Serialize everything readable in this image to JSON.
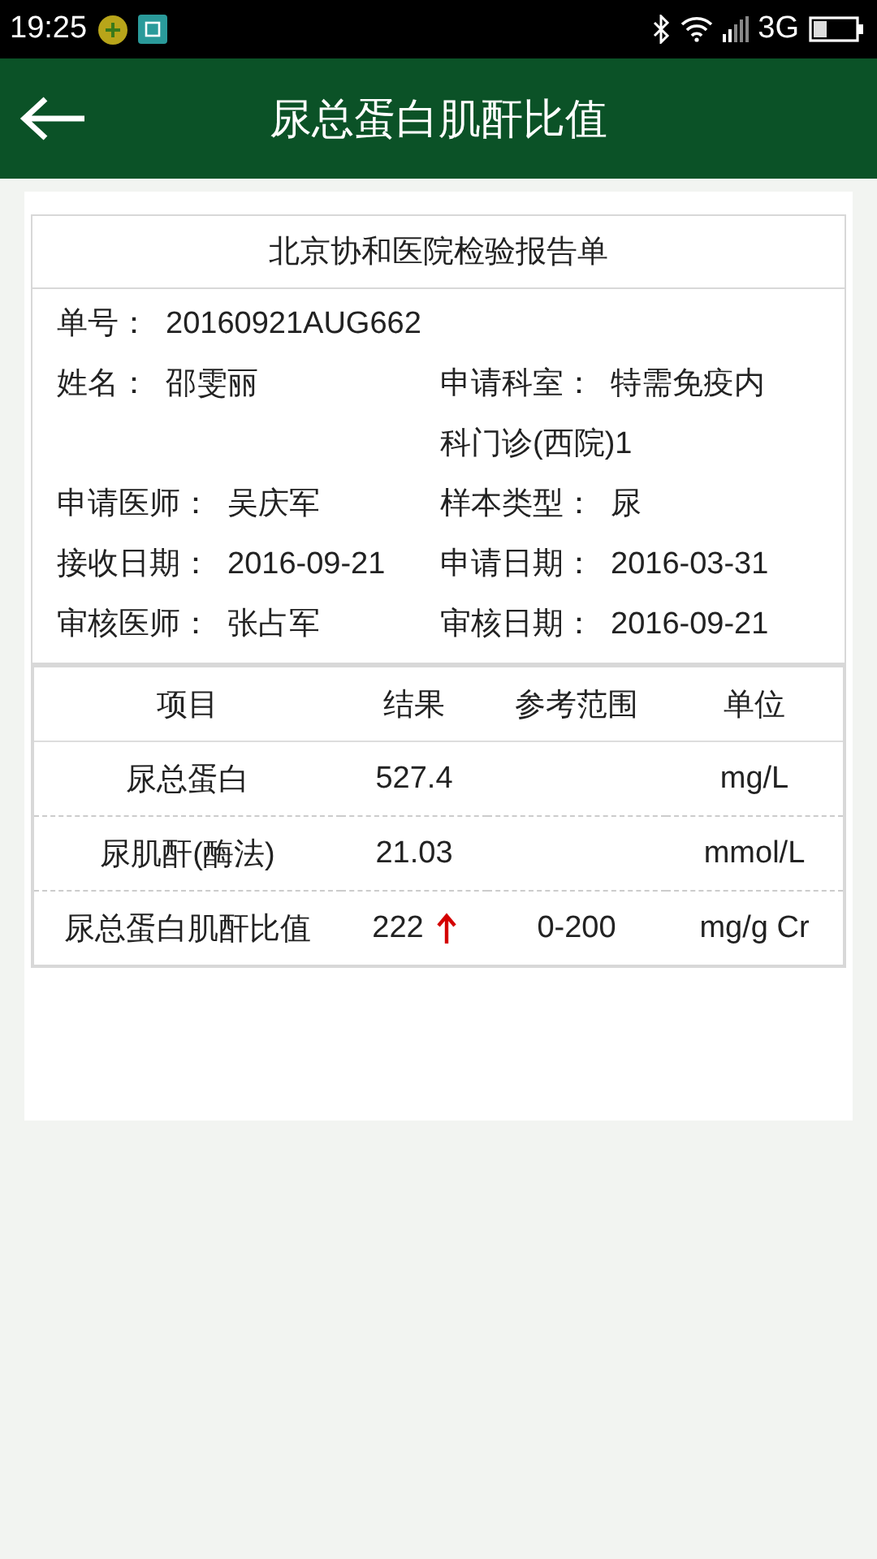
{
  "status_bar": {
    "time": "19:25",
    "network": "3G"
  },
  "header": {
    "title": "尿总蛋白肌酐比值"
  },
  "report": {
    "title": "北京协和医院检验报告单",
    "info_rows": [
      [
        {
          "label": "单号：",
          "value": "20160921AUG662"
        }
      ],
      [
        {
          "label": "姓名：",
          "value": "邵雯丽"
        },
        {
          "label": "申请科室：",
          "value": "特需免疫内科门诊(西院)1"
        }
      ],
      [
        {
          "label": "申请医师：",
          "value": "吴庆军"
        },
        {
          "label": "样本类型：",
          "value": "尿"
        }
      ],
      [
        {
          "label": "接收日期：",
          "value": "2016-09-21"
        },
        {
          "label": "申请日期：",
          "value": "2016-03-31"
        }
      ],
      [
        {
          "label": "审核医师：",
          "value": "张占军"
        },
        {
          "label": "审核日期：",
          "value": "2016-09-21"
        }
      ]
    ],
    "table": {
      "columns": [
        "项目",
        "结果",
        "参考范围",
        "单位"
      ],
      "rows": [
        {
          "item": "尿总蛋白",
          "result": "527.4",
          "abnormal": false,
          "range": "",
          "unit": "mg/L"
        },
        {
          "item": "尿肌酐(酶法)",
          "result": "21.03",
          "abnormal": false,
          "range": "",
          "unit": "mmol/L"
        },
        {
          "item": "尿总蛋白肌酐比值",
          "result": "222",
          "abnormal": true,
          "range": "0-200",
          "unit": "mg/g Cr"
        }
      ]
    }
  }
}
